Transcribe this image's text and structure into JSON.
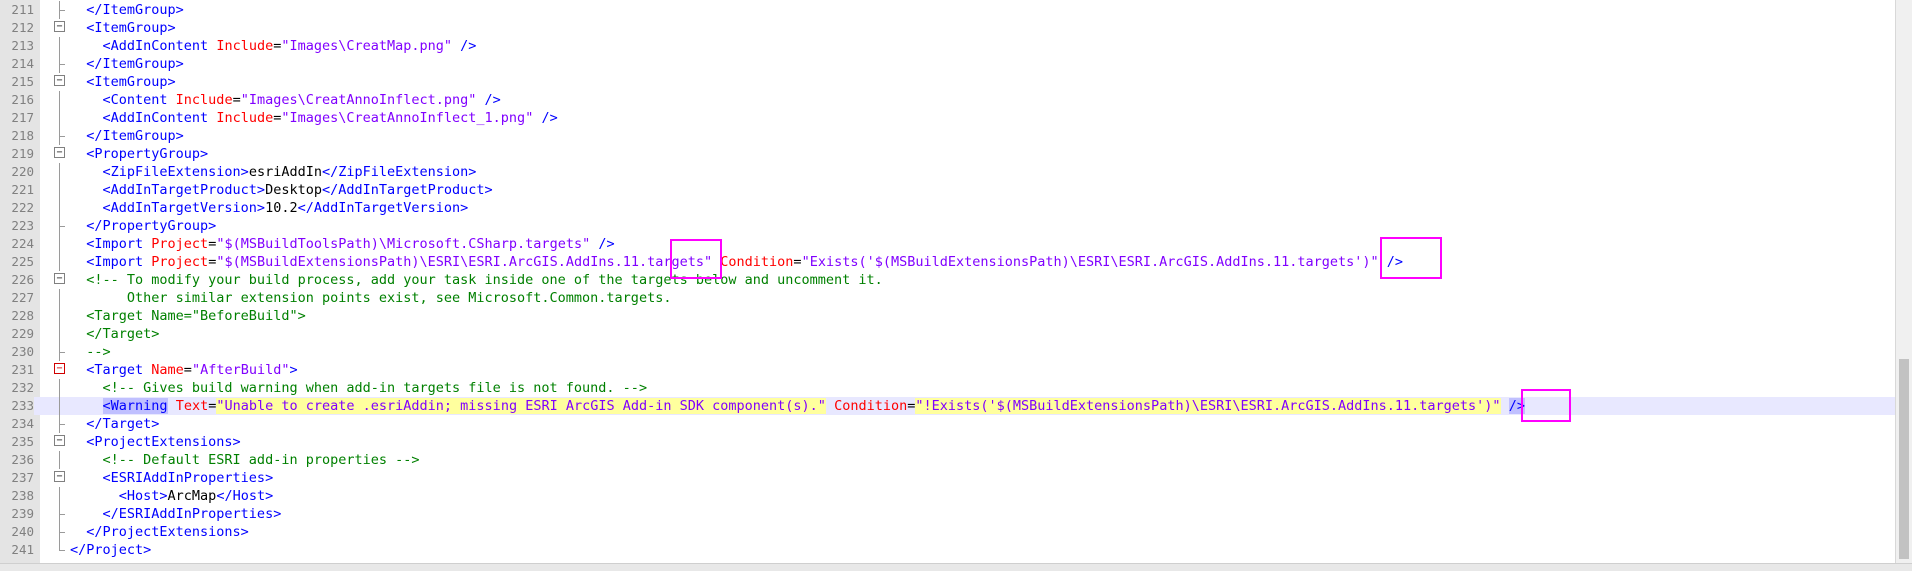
{
  "lines": [
    {
      "num": "211",
      "tokens": [
        {
          "k": "t",
          "s": "  </ItemGroup>"
        }
      ]
    },
    {
      "num": "212",
      "tokens": [
        {
          "k": "t",
          "s": "  <ItemGroup>"
        }
      ]
    },
    {
      "num": "213",
      "tokens": [
        {
          "k": "t",
          "s": "    <AddInContent "
        },
        {
          "k": "a",
          "s": "Include"
        },
        {
          "k": "x",
          "s": "="
        },
        {
          "k": "v",
          "s": "\"Images\\CreatMap.png\""
        },
        {
          "k": "t",
          "s": " />"
        }
      ]
    },
    {
      "num": "214",
      "tokens": [
        {
          "k": "t",
          "s": "  </ItemGroup>"
        }
      ]
    },
    {
      "num": "215",
      "tokens": [
        {
          "k": "t",
          "s": "  <ItemGroup>"
        }
      ]
    },
    {
      "num": "216",
      "tokens": [
        {
          "k": "t",
          "s": "    <Content "
        },
        {
          "k": "a",
          "s": "Include"
        },
        {
          "k": "x",
          "s": "="
        },
        {
          "k": "v",
          "s": "\"Images\\CreatAnnoInflect.png\""
        },
        {
          "k": "t",
          "s": " />"
        }
      ]
    },
    {
      "num": "217",
      "tokens": [
        {
          "k": "t",
          "s": "    <AddInContent "
        },
        {
          "k": "a",
          "s": "Include"
        },
        {
          "k": "x",
          "s": "="
        },
        {
          "k": "v",
          "s": "\"Images\\CreatAnnoInflect_1.png\""
        },
        {
          "k": "t",
          "s": " />"
        }
      ]
    },
    {
      "num": "218",
      "tokens": [
        {
          "k": "t",
          "s": "  </ItemGroup>"
        }
      ]
    },
    {
      "num": "219",
      "tokens": [
        {
          "k": "t",
          "s": "  <PropertyGroup>"
        }
      ]
    },
    {
      "num": "220",
      "tokens": [
        {
          "k": "t",
          "s": "    <ZipFileExtension>"
        },
        {
          "k": "x",
          "s": "esriAddIn"
        },
        {
          "k": "t",
          "s": "</ZipFileExtension>"
        }
      ]
    },
    {
      "num": "221",
      "tokens": [
        {
          "k": "t",
          "s": "    <AddInTargetProduct>"
        },
        {
          "k": "x",
          "s": "Desktop"
        },
        {
          "k": "t",
          "s": "</AddInTargetProduct>"
        }
      ]
    },
    {
      "num": "222",
      "tokens": [
        {
          "k": "t",
          "s": "    <AddInTargetVersion>"
        },
        {
          "k": "x",
          "s": "10.2"
        },
        {
          "k": "t",
          "s": "</AddInTargetVersion>"
        }
      ]
    },
    {
      "num": "223",
      "tokens": [
        {
          "k": "t",
          "s": "  </PropertyGroup>"
        }
      ]
    },
    {
      "num": "224",
      "tokens": [
        {
          "k": "t",
          "s": "  <Import "
        },
        {
          "k": "a",
          "s": "Project"
        },
        {
          "k": "x",
          "s": "="
        },
        {
          "k": "v",
          "s": "\"$(MSBuildToolsPath)\\Microsoft.CSharp.targets\""
        },
        {
          "k": "t",
          "s": " />"
        }
      ]
    },
    {
      "num": "225",
      "tokens": [
        {
          "k": "t",
          "s": "  <Import "
        },
        {
          "k": "a",
          "s": "Project"
        },
        {
          "k": "x",
          "s": "="
        },
        {
          "k": "v",
          "s": "\"$(MSBuildExtensionsPath)\\ESRI\\ESRI.ArcGIS.AddIns.11.targets\""
        },
        {
          "k": "x",
          "s": " "
        },
        {
          "k": "a",
          "s": "Condition"
        },
        {
          "k": "x",
          "s": "="
        },
        {
          "k": "v",
          "s": "\"Exists('$(MSBuildExtensionsPath)\\ESRI\\ESRI.ArcGIS.AddIns.11.targets')\""
        },
        {
          "k": "t",
          "s": " />"
        }
      ]
    },
    {
      "num": "226",
      "tokens": [
        {
          "k": "c",
          "s": "  <!-- To modify your build process, add your task inside one of the targets below and uncomment it."
        }
      ]
    },
    {
      "num": "227",
      "tokens": [
        {
          "k": "c",
          "s": "       Other similar extension points exist, see Microsoft.Common.targets."
        }
      ]
    },
    {
      "num": "228",
      "tokens": [
        {
          "k": "c",
          "s": "  <Target Name=\"BeforeBuild\">"
        }
      ]
    },
    {
      "num": "229",
      "tokens": [
        {
          "k": "c",
          "s": "  </Target>"
        }
      ]
    },
    {
      "num": "230",
      "tokens": [
        {
          "k": "c",
          "s": "  -->"
        }
      ]
    },
    {
      "num": "231",
      "tokens": [
        {
          "k": "t",
          "s": "  <Target "
        },
        {
          "k": "a",
          "s": "Name"
        },
        {
          "k": "x",
          "s": "="
        },
        {
          "k": "v",
          "s": "\"AfterBuild\""
        },
        {
          "k": "t",
          "s": ">"
        }
      ]
    },
    {
      "num": "232",
      "tokens": [
        {
          "k": "c",
          "s": "    <!-- Gives build warning when add-in targets file is not found. -->"
        }
      ]
    },
    {
      "num": "233",
      "tokens": [
        {
          "k": "x",
          "s": "    "
        },
        {
          "k": "tsel",
          "s": "<Warning"
        },
        {
          "k": "t",
          "s": " "
        },
        {
          "k": "a",
          "s": "Text"
        },
        {
          "k": "x",
          "s": "="
        },
        {
          "k": "vh",
          "s": "\"Unable to create .esriAddin; missing ESRI ArcGIS Add-in SDK component(s).\""
        },
        {
          "k": "x",
          "s": " "
        },
        {
          "k": "a",
          "s": "Condition"
        },
        {
          "k": "x",
          "s": "="
        },
        {
          "k": "vh",
          "s": "\"!Exists('$(MSBuildExtensionsPath)\\ESRI\\ESRI.ArcGIS.AddIns.11.targets')\""
        },
        {
          "k": "x",
          "s": " "
        },
        {
          "k": "tsel",
          "s": "/>"
        }
      ]
    },
    {
      "num": "234",
      "tokens": [
        {
          "k": "t",
          "s": "  </Target>"
        }
      ]
    },
    {
      "num": "235",
      "tokens": [
        {
          "k": "t",
          "s": "  <ProjectExtensions>"
        }
      ]
    },
    {
      "num": "236",
      "tokens": [
        {
          "k": "c",
          "s": "    <!-- Default ESRI add-in properties -->"
        }
      ]
    },
    {
      "num": "237",
      "tokens": [
        {
          "k": "t",
          "s": "    <ESRIAddInProperties>"
        }
      ]
    },
    {
      "num": "238",
      "tokens": [
        {
          "k": "t",
          "s": "      <Host>"
        },
        {
          "k": "x",
          "s": "ArcMap"
        },
        {
          "k": "t",
          "s": "</Host>"
        }
      ]
    },
    {
      "num": "239",
      "tokens": [
        {
          "k": "t",
          "s": "    </ESRIAddInProperties>"
        }
      ]
    },
    {
      "num": "240",
      "tokens": [
        {
          "k": "t",
          "s": "  </ProjectExtensions>"
        }
      ]
    },
    {
      "num": "241",
      "tokens": [
        {
          "k": "t",
          "s": "</Project>"
        }
      ]
    }
  ],
  "fold": {
    "211": "tick",
    "212": "open",
    "213": "line",
    "214": "tick",
    "215": "open",
    "216": "line",
    "217": "line",
    "218": "tick",
    "219": "open",
    "220": "line",
    "221": "line",
    "222": "line",
    "223": "tick",
    "224": "line",
    "225": "line",
    "226": "open",
    "227": "line",
    "228": "line",
    "229": "line",
    "230": "tick",
    "231": "open-red",
    "232": "line",
    "233": "line",
    "234": "tick",
    "235": "open",
    "236": "line",
    "237": "open",
    "238": "line",
    "239": "tick",
    "240": "tick",
    "241": "end"
  },
  "current_line": "233",
  "annotation_boxes": [
    {
      "line": "224",
      "label": "highlight-box-224"
    },
    {
      "line": "225",
      "label": "highlight-box-225"
    },
    {
      "line": "233",
      "label": "highlight-box-233"
    }
  ],
  "colors": {
    "tag": "#0000ff",
    "attribute": "#ff0000",
    "value": "#8000ff",
    "text": "#000000",
    "comment": "#008000",
    "current_line": "#e8e8ff",
    "annotation": "#ff00ff"
  }
}
